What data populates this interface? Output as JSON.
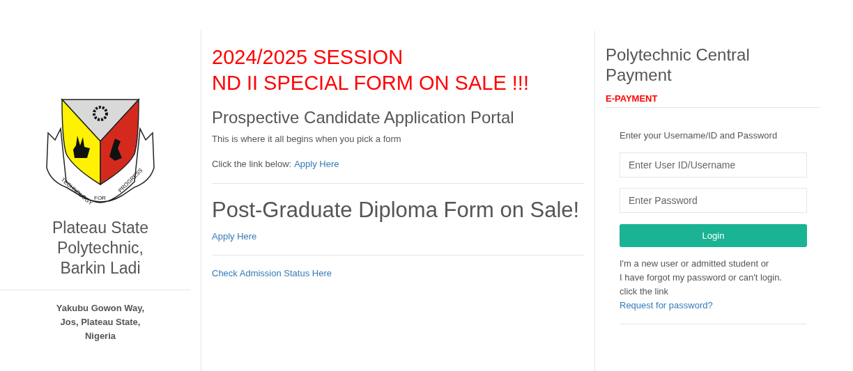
{
  "logo": {
    "motto": [
      "TECHNOLOGY",
      "FOR",
      "PROGRESS"
    ]
  },
  "institution": {
    "name": "Plateau State Polytechnic, Barkin Ladi",
    "address": "Yakubu Gowon Way, Jos, Plateau State, Nigeria"
  },
  "announcement": {
    "lines": [
      "2024/2025 SESSION",
      "ND II SPECIAL FORM ON SALE !!!"
    ]
  },
  "portal": {
    "title": "Prospective Candidate Application Portal",
    "intro": "This is where it all begins when you pick a form",
    "prompt": "Click the link below:",
    "link": "Apply Here"
  },
  "postgraduate": {
    "title": "Post-Graduate Diploma Form on Sale!",
    "link": "Apply Here"
  },
  "admission_link": "Check Admission Status Here",
  "payment": {
    "title": "Polytechnic Central Payment",
    "subtitle": "E-PAYMENT",
    "instruction": "Enter your Username/ID and Password",
    "fields": [
      {
        "placeholder": "Enter User ID/Username"
      },
      {
        "placeholder": "Enter Password"
      }
    ],
    "button": "Login",
    "help_lines": [
      "I'm a new user or admitted student or",
      "I have forgot my password or can't login.",
      "click the link"
    ],
    "help_link": "Request for password?"
  }
}
